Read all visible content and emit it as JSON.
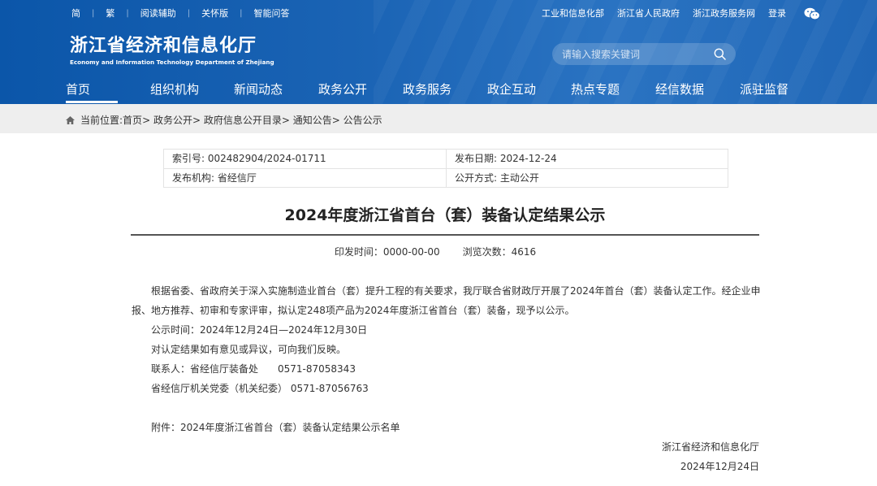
{
  "topbar": {
    "left": [
      "简",
      "繁",
      "阅读辅助",
      "关怀版",
      "智能问答"
    ],
    "right": [
      "工业和信息化部",
      "浙江省人民政府",
      "浙江政务服务网",
      "登录"
    ]
  },
  "logo": {
    "cn": "浙江省经济和信息化厅",
    "en": "Economy and Information Technology Department of Zhejiang"
  },
  "search": {
    "placeholder": "请输入搜索关键词"
  },
  "nav": [
    "首页",
    "组织机构",
    "新闻动态",
    "政务公开",
    "政务服务",
    "政企互动",
    "热点专题",
    "经信数据",
    "派驻监督"
  ],
  "breadcrumb": {
    "prefix": "当前位置:",
    "items": [
      "首页",
      "政务公开",
      "政府信息公开目录",
      "通知公告",
      "公告公示"
    ]
  },
  "meta": {
    "index_no": "索引号: 002482904/2024-01711",
    "publish_date": "发布日期: 2024-12-24",
    "issuer": "发布机构: 省经信厅",
    "open_mode": "公开方式: 主动公开"
  },
  "article": {
    "title": "2024年度浙江省首台（套）装备认定结果公示",
    "print_time": "印发时间：0000-00-00",
    "views": "浏览次数：4616",
    "lines": [
      "根据省委、省政府关于深入实施制造业首台（套）提升工程的有关要求，我厅联合省财政厅开展了2024年首台（套）装备认定工作。经企业申",
      "报、地方推荐、初审和专家评审，拟认定248项产品为2024年度浙江省首台（套）装备，现予以公示。",
      "公示时间：2024年12月24日—2024年12月30日",
      "对认定结果如有意见或异议，可向我们反映。",
      "联系人：省经信厅装备处　　0571-87058343",
      "省经信厅机关党委（机关纪委）  0571-87056763",
      "附件：2024年度浙江省首台（套）装备认定结果公示名单",
      "浙江省经济和信息化厅",
      "2024年12月24日"
    ]
  }
}
